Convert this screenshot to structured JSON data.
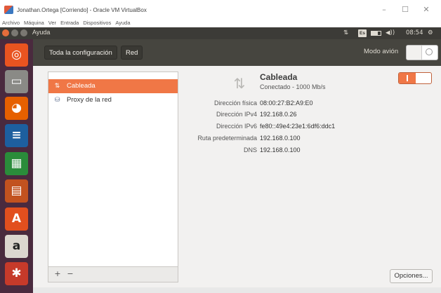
{
  "vbox": {
    "title": "Jonathan.Ortega [Corriendo] - Oracle VM VirtualBox",
    "menus": [
      "Archivo",
      "Máquina",
      "Ver",
      "Entrada",
      "Dispositivos",
      "Ayuda"
    ],
    "minimize": "–",
    "restore": "☐",
    "close": "✕"
  },
  "panel": {
    "app_name": "Ayuda",
    "network_indicator": "⇅",
    "keyboard_layout": "Es",
    "volume": "◀))",
    "clock": "08:54",
    "settings_glyph": "⚙"
  },
  "launcher": {
    "items": [
      {
        "icon": "ubuntu-dash-icon",
        "glyph": "◎",
        "color": "#e95420"
      },
      {
        "icon": "files-icon",
        "glyph": "▭",
        "color": "#8a8a86"
      },
      {
        "icon": "firefox-icon",
        "glyph": "◕",
        "color": "#e66000"
      },
      {
        "icon": "writer-icon",
        "glyph": "≡",
        "color": "#1d5f9f"
      },
      {
        "icon": "calc-icon",
        "glyph": "▦",
        "color": "#2a8c3a"
      },
      {
        "icon": "impress-icon",
        "glyph": "▤",
        "color": "#c2521f"
      },
      {
        "icon": "software-center-icon",
        "glyph": "A",
        "color": "#e24f1e"
      },
      {
        "icon": "amazon-icon",
        "glyph": "a",
        "color": "#dcd6cf"
      },
      {
        "icon": "system-settings-icon",
        "glyph": "✱",
        "color": "#c63a2a"
      }
    ]
  },
  "header": {
    "all_settings": "Toda la configuración",
    "section": "Red",
    "airplane_mode_label": "Modo avión"
  },
  "devices": {
    "items": [
      {
        "label": "Cableada",
        "glyph": "⇅"
      },
      {
        "label": "Proxy de la red",
        "glyph": "⛁"
      }
    ],
    "add": "+",
    "remove": "−"
  },
  "detail": {
    "title": "Cableada",
    "status": "Conectado - 1000 Mb/s",
    "properties": [
      {
        "label": "Dirección física",
        "value": "08:00:27:B2:A9:E0"
      },
      {
        "label": "Dirección IPv4",
        "value": "192.168.0.26"
      },
      {
        "label": "Dirección IPv6",
        "value": "fe80::49e4:23e1:6df6:ddc1"
      },
      {
        "label": "Ruta predeterminada",
        "value": "192.168.0.100"
      },
      {
        "label": "DNS",
        "value": "192.168.0.100"
      }
    ],
    "options_button": "Opciones..."
  },
  "colors": {
    "accent": "#f07746",
    "launcher_bg": "#4a2a3e",
    "panel_bg": "#3c3b37",
    "header_bg": "#46453f"
  }
}
